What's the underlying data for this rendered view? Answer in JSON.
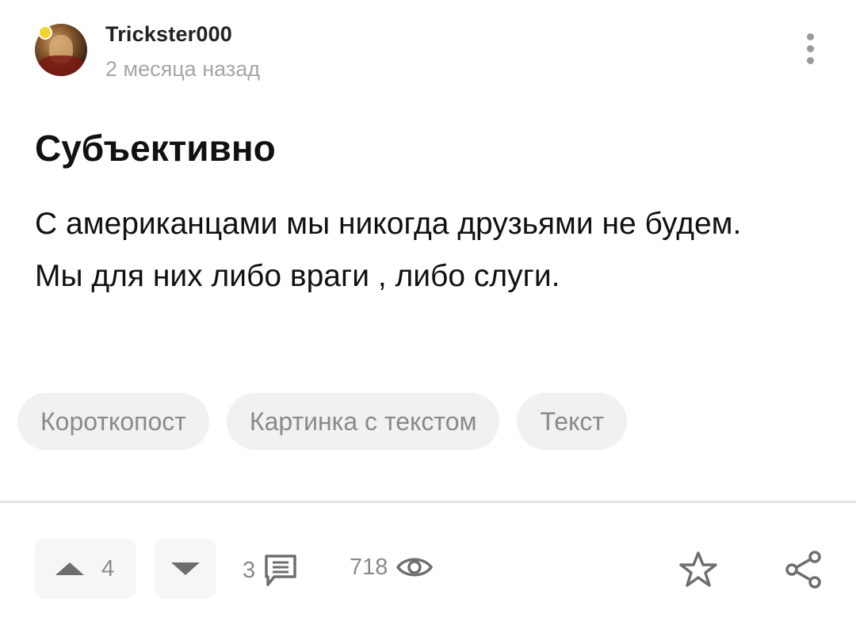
{
  "post": {
    "author": "Trickster000",
    "time_ago": "2 месяца назад",
    "title": "Субъективно",
    "body": [
      "С американцами мы никогда друзьями не будем.",
      "Мы для них либо враги , либо слуги."
    ],
    "tags": [
      "Короткопост",
      "Картинка с текстом",
      "Текст"
    ]
  },
  "stats": {
    "rating": "4",
    "comments": "3",
    "views": "718"
  },
  "icons": {
    "menu": "more-vertical-icon",
    "upvote": "triangle-up-icon",
    "downvote": "triangle-down-icon",
    "comments": "comment-icon",
    "views": "eye-icon",
    "favorite": "star-icon",
    "share": "share-icon"
  },
  "colors": {
    "muted_text": "#8a8a8a",
    "tag_bg": "#f1f1f1",
    "badge": "#f5d431"
  }
}
